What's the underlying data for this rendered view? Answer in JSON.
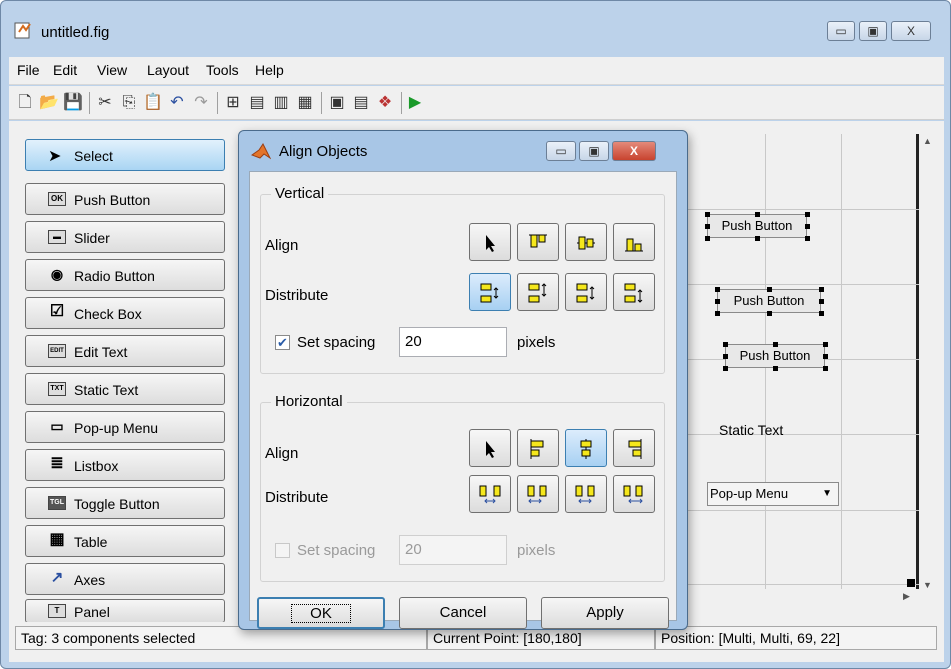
{
  "window": {
    "title": "untitled.fig",
    "minimize_label": "▭",
    "maximize_label": "▣",
    "close_label": "X"
  },
  "menu": [
    "File",
    "Edit",
    "View",
    "Layout",
    "Tools",
    "Help"
  ],
  "toolbar_icons": [
    "new-icon",
    "open-icon",
    "save-icon",
    "cut-icon",
    "copy-icon",
    "paste-icon",
    "undo-icon",
    "redo-icon",
    "align-icon",
    "menu-editor-icon",
    "tab-order-icon",
    "toolbar-editor-icon",
    "editor-icon",
    "property-inspector-icon",
    "object-browser-icon",
    "run-icon"
  ],
  "palette": {
    "select": "Select",
    "items": [
      {
        "label": "Push Button",
        "glyph": "OK"
      },
      {
        "label": "Slider",
        "glyph": "▬"
      },
      {
        "label": "Radio Button",
        "glyph": "◉"
      },
      {
        "label": "Check Box",
        "glyph": "☑"
      },
      {
        "label": "Edit Text",
        "glyph": "EDIT"
      },
      {
        "label": "Static Text",
        "glyph": "TXT"
      },
      {
        "label": "Pop-up Menu",
        "glyph": "▭"
      },
      {
        "label": "Listbox",
        "glyph": "≣"
      },
      {
        "label": "Toggle Button",
        "glyph": "TGL"
      },
      {
        "label": "Table",
        "glyph": "▦"
      },
      {
        "label": "Axes",
        "glyph": "↗"
      },
      {
        "label": "Panel",
        "glyph": "T"
      }
    ]
  },
  "canvas": {
    "buttons": [
      "Push Button",
      "Push Button",
      "Push Button"
    ],
    "static_text": "Static Text",
    "popup": "Pop-up Menu"
  },
  "status": {
    "tag": "Tag: 3 components selected",
    "current_point": "Current Point: [180,180]",
    "position": "Position: [Multi, Multi, 69, 22]"
  },
  "dialog": {
    "title": "Align Objects",
    "vertical": {
      "group": "Vertical",
      "align": "Align",
      "distribute": "Distribute",
      "set_spacing": "Set spacing",
      "spacing_value": "20",
      "units": "pixels"
    },
    "horizontal": {
      "group": "Horizontal",
      "align": "Align",
      "distribute": "Distribute",
      "set_spacing": "Set spacing",
      "spacing_value": "20",
      "units": "pixels"
    },
    "ok": "OK",
    "cancel": "Cancel",
    "apply": "Apply"
  },
  "colors": {
    "accent": "#3c7fb1",
    "icon_fill": "#f5e71c",
    "close_button": "#c8432f"
  }
}
